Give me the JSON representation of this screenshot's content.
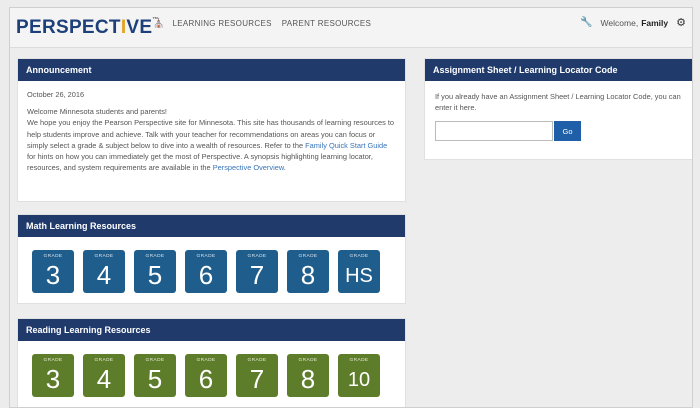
{
  "header": {
    "logo_prefix": "PERSPECT",
    "logo_accent": "I",
    "logo_suffix": "VE",
    "logo_mark": "™",
    "nav": [
      {
        "label": "LEARNING RESOURCES"
      },
      {
        "label": "PARENT RESOURCES"
      }
    ],
    "welcome_label": "Welcome,",
    "user_name": "Family"
  },
  "announcement": {
    "title": "Announcement",
    "date": "October 26, 2016",
    "text_1": "Welcome Minnesota students and parents!",
    "text_2": "We hope you enjoy the Pearson Perspective site for Minnesota. This site has thousands of learning resources to help students improve and achieve. Talk with your teacher for recommendations on areas you can focus or simply select a grade & subject below to dive into a wealth of resources. Refer to the ",
    "link_1": "Family Quick Start Guide",
    "text_3": " for hints on how you can immediately get the most of Perspective. A synopsis highlighting learning locator, resources, and system requirements are available in the ",
    "link_2": "Perspective Overview",
    "text_4": "."
  },
  "assignment": {
    "title": "Assignment Sheet / Learning Locator Code",
    "text": "If you already have an Assignment Sheet / Learning Locator Code, you can enter it here.",
    "input_value": "",
    "go_label": "Go"
  },
  "math": {
    "title": "Math Learning Resources",
    "grade_label": "GRADE",
    "grades": [
      "3",
      "4",
      "5",
      "6",
      "7",
      "8",
      "HS"
    ],
    "color": "#1f5d8c"
  },
  "reading": {
    "title": "Reading Learning Resources",
    "grade_label": "GRADE",
    "grades": [
      "3",
      "4",
      "5",
      "6",
      "7",
      "8",
      "10"
    ],
    "color": "#5e7d2b"
  },
  "colors": {
    "panel_header": "#1f3a6b",
    "logo": "#1d3f7a",
    "logo_accent": "#e3a21a",
    "link": "#3a74b8",
    "go_button": "#1e5fa7"
  },
  "icons": [
    "home-icon",
    "wrench-icon",
    "gear-icon"
  ]
}
